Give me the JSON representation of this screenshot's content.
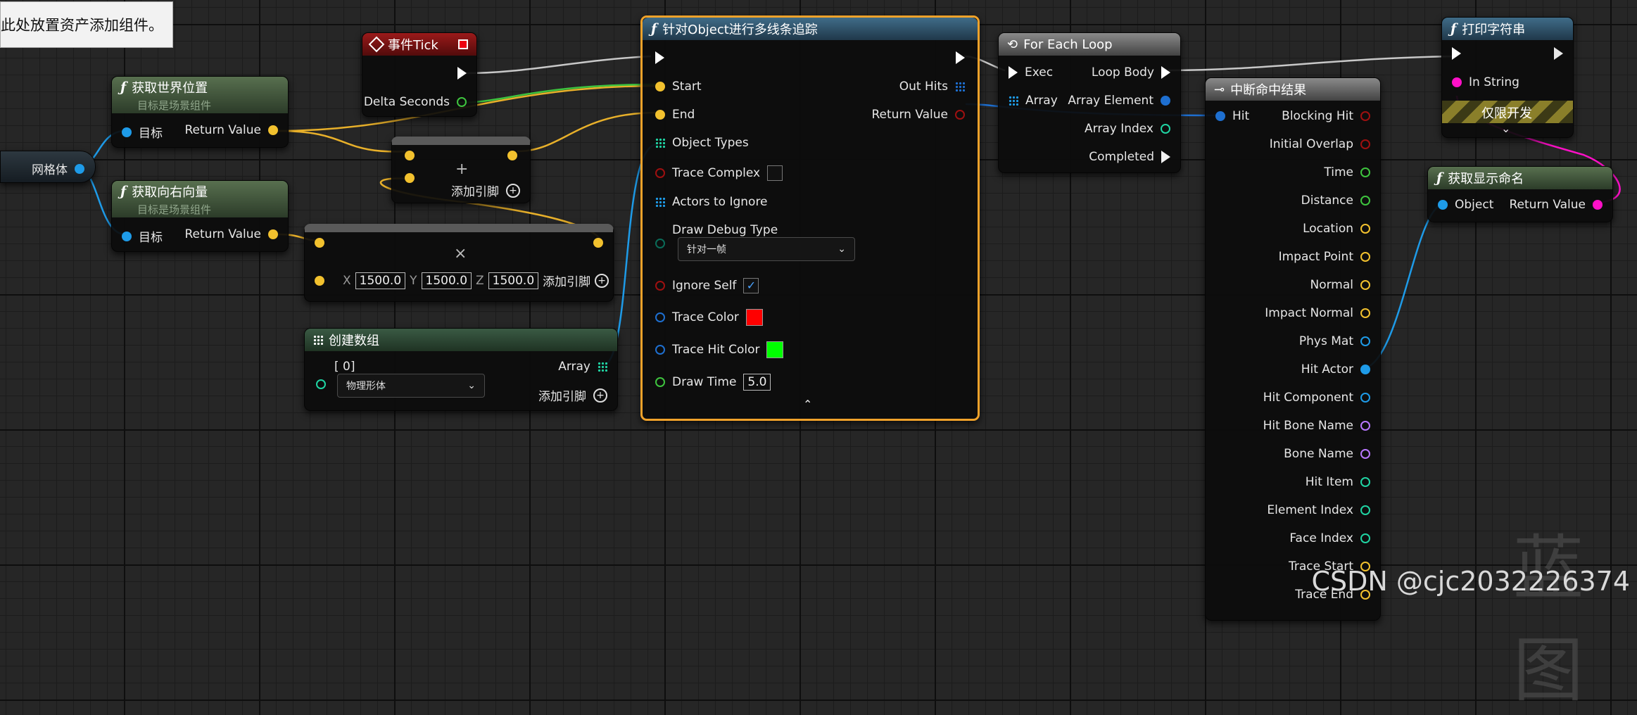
{
  "comment": {
    "text": "此处放置资产添加组件。"
  },
  "mesh_var": {
    "label": "网格体"
  },
  "node_get_world_location": {
    "title": "获取世界位置",
    "subtitle": "目标是场景组件",
    "target": "目标",
    "return": "Return Value"
  },
  "node_get_right_vector": {
    "title": "获取向右向量",
    "subtitle": "目标是场景组件",
    "target": "目标",
    "return": "Return Value"
  },
  "node_event_tick": {
    "title": "事件Tick",
    "delta": "Delta Seconds"
  },
  "node_add": {
    "add_pin": "添加引脚"
  },
  "node_multiply": {
    "x_label": "X",
    "x": "1500.0",
    "y_label": "Y",
    "y": "1500.0",
    "z_label": "Z",
    "z": "1500.0",
    "add_pin": "添加引脚"
  },
  "node_make_array": {
    "title": "创建数组",
    "index": "[ 0]",
    "option": "物理形体",
    "array": "Array",
    "add_pin": "添加引脚"
  },
  "node_trace": {
    "title": "针对Object进行多线条追踪",
    "start": "Start",
    "end": "End",
    "object_types": "Object Types",
    "trace_complex": "Trace Complex",
    "actors_to_ignore": "Actors to Ignore",
    "draw_debug_type": "Draw Debug Type",
    "debug_option": "针对一帧",
    "ignore_self": "Ignore Self",
    "trace_color": "Trace Color",
    "trace_hit_color": "Trace Hit Color",
    "draw_time": "Draw Time",
    "draw_time_value": "5.0",
    "out_hits": "Out Hits",
    "return": "Return Value"
  },
  "node_foreach": {
    "title": "For Each Loop",
    "exec": "Exec",
    "array": "Array",
    "loop_body": "Loop Body",
    "element": "Array Element",
    "index": "Array Index",
    "completed": "Completed"
  },
  "node_break_hit": {
    "title": "中断命中结果",
    "hit": "Hit",
    "outputs": [
      "Blocking Hit",
      "Initial Overlap",
      "Time",
      "Distance",
      "Location",
      "Impact Point",
      "Normal",
      "Impact Normal",
      "Phys Mat",
      "Hit Actor",
      "Hit Component",
      "Hit Bone Name",
      "Bone Name",
      "Hit Item",
      "Element Index",
      "Face Index",
      "Trace Start",
      "Trace End"
    ]
  },
  "node_print": {
    "title": "打印字符串",
    "in_string": "In String",
    "dev_only": "仅限开发"
  },
  "node_display_name": {
    "title": "获取显示命名",
    "object": "Object",
    "return": "Return Value"
  },
  "watermark": {
    "text": "CSDN @cjc2032226374",
    "logo": "蓝图"
  },
  "colors": {
    "trace_color": "#ff0000",
    "trace_hit_color": "#00ff00",
    "selection": "#f0a22a",
    "vector_pin": "#f2c12e",
    "object_pin": "#1e9be8",
    "float_pin": "#3ec43e",
    "struct_pin": "#1e6fd0",
    "bool_pin": "#9e1010",
    "string_pin": "#ff10c8",
    "name_pin": "#b877ff",
    "int_pin": "#20d4a3"
  }
}
